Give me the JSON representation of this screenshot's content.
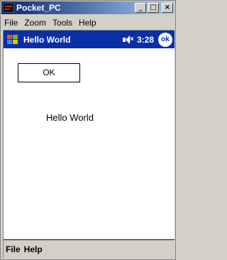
{
  "window": {
    "title": "Pocket_PC",
    "min_label": "_",
    "max_label": "□",
    "close_label": "×"
  },
  "host_menu": [
    "File",
    "Zoom",
    "Tools",
    "Help"
  ],
  "navbar": {
    "title": "Hello World",
    "time": "3:28",
    "ok_label": "ok"
  },
  "content": {
    "button_label": "OK",
    "label": "Hello World"
  },
  "device_menu": [
    "File",
    "Help"
  ],
  "colors": {
    "navbar_bg": "#0a2ea8",
    "titlebar_start": "#0a246a",
    "chrome": "#d4d0c8"
  }
}
